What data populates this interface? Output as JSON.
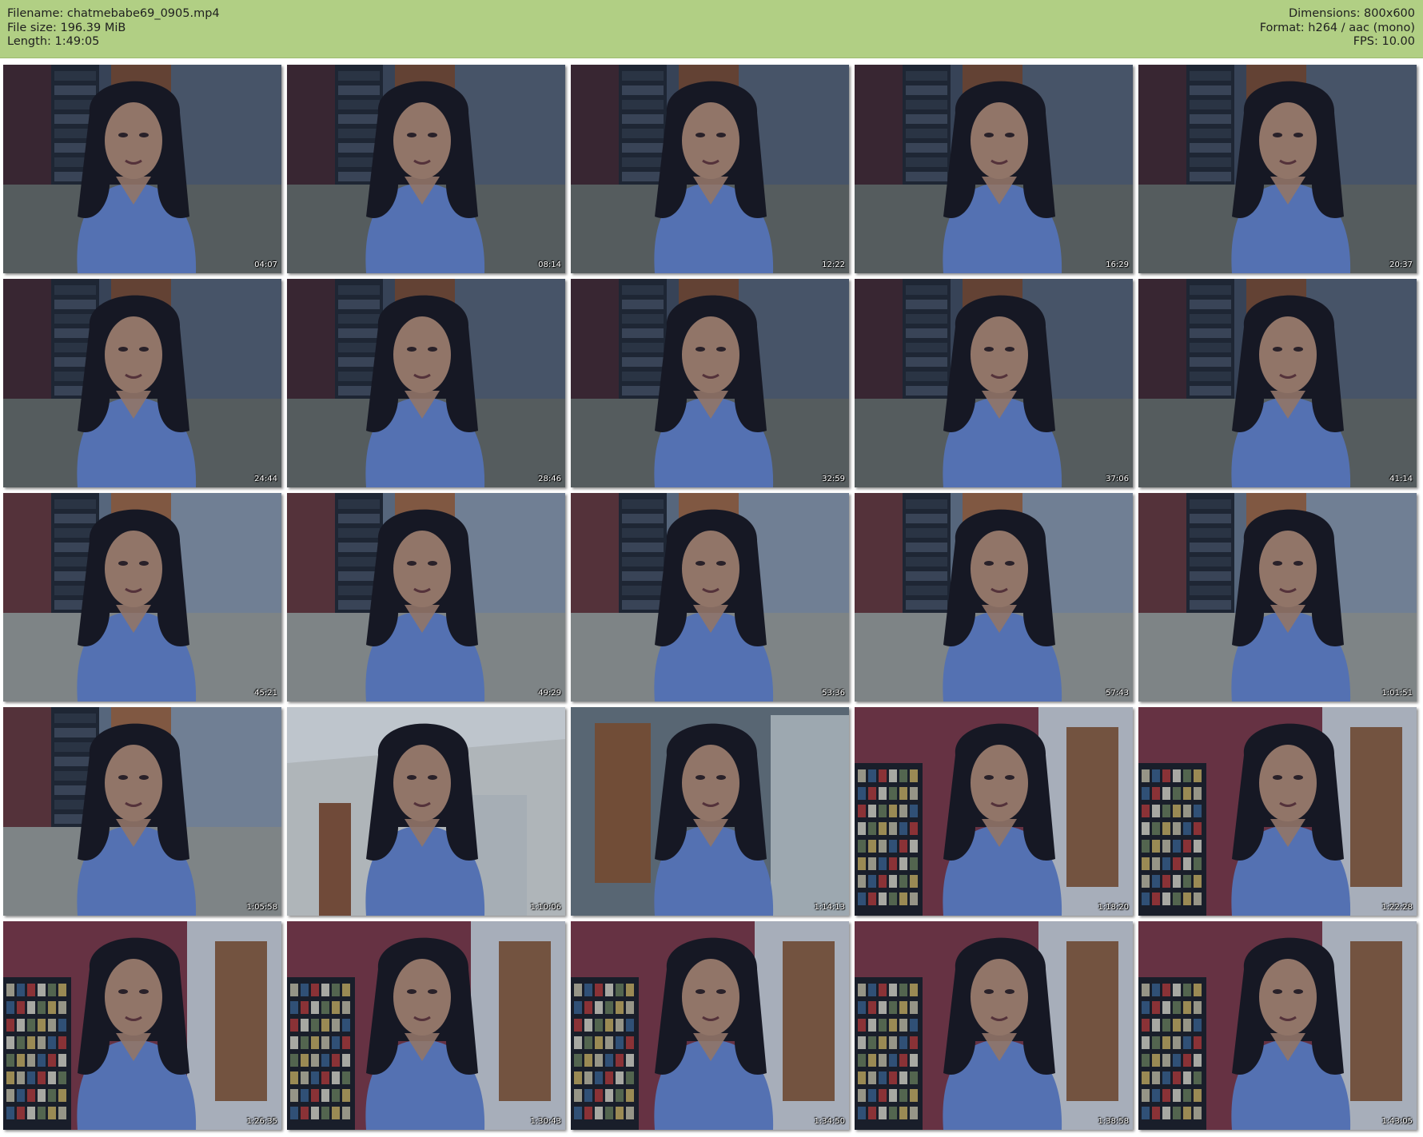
{
  "header": {
    "filename_line": "Filename: chatmebabe69_0905.mp4",
    "filesize_line": "File size: 196.39 MiB",
    "length_line": "Length: 1:49:05",
    "dimensions_line": "Dimensions: 800x600",
    "format_line": "Format: h264 / aac (mono)",
    "fps_line": "FPS: 10.00",
    "background_color": "#b1cf84"
  },
  "thumbnails": [
    {
      "timestamp": "04:07",
      "scene": "bookshelf-door"
    },
    {
      "timestamp": "08:14",
      "scene": "bookshelf-door"
    },
    {
      "timestamp": "12:22",
      "scene": "bookshelf-door"
    },
    {
      "timestamp": "16:29",
      "scene": "bookshelf-door"
    },
    {
      "timestamp": "20:37",
      "scene": "bookshelf-door"
    },
    {
      "timestamp": "24:44",
      "scene": "bookshelf-door"
    },
    {
      "timestamp": "28:46",
      "scene": "bookshelf-door"
    },
    {
      "timestamp": "32:59",
      "scene": "bookshelf-door"
    },
    {
      "timestamp": "37:06",
      "scene": "bookshelf-door"
    },
    {
      "timestamp": "41:14",
      "scene": "bookshelf-door"
    },
    {
      "timestamp": "45:21",
      "scene": "bookshelf-door-bright"
    },
    {
      "timestamp": "49:29",
      "scene": "bookshelf-door-bright"
    },
    {
      "timestamp": "53:36",
      "scene": "bookshelf-door-bright"
    },
    {
      "timestamp": "57:43",
      "scene": "bookshelf-door-bright"
    },
    {
      "timestamp": "1:01:51",
      "scene": "bookshelf-door-bright"
    },
    {
      "timestamp": "1:05:58",
      "scene": "bookshelf-door-bright"
    },
    {
      "timestamp": "1:10:06",
      "scene": "ceiling-room"
    },
    {
      "timestamp": "1:14:13",
      "scene": "closeup-door"
    },
    {
      "timestamp": "1:18:20",
      "scene": "red-wall-shelf"
    },
    {
      "timestamp": "1:22:28",
      "scene": "red-wall-shelf"
    },
    {
      "timestamp": "1:26:35",
      "scene": "red-wall-shelf"
    },
    {
      "timestamp": "1:30:43",
      "scene": "red-wall-shelf"
    },
    {
      "timestamp": "1:34:50",
      "scene": "red-wall-shelf"
    },
    {
      "timestamp": "1:38:58",
      "scene": "red-wall-shelf"
    },
    {
      "timestamp": "1:43:05",
      "scene": "red-wall-shelf"
    }
  ]
}
